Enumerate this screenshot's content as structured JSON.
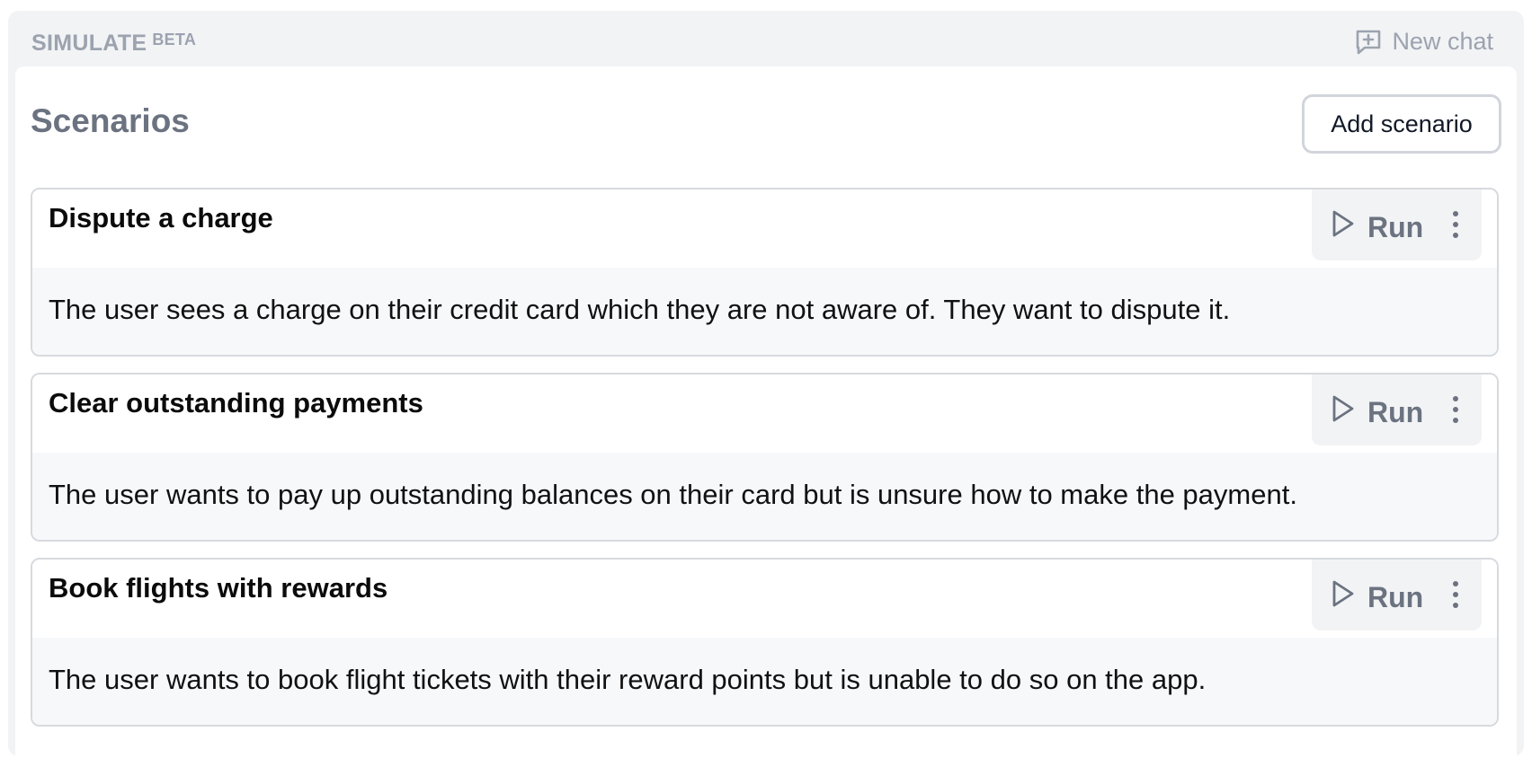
{
  "header": {
    "brand": "SIMULATE",
    "badge": "BETA",
    "new_chat_label": "New chat"
  },
  "main": {
    "title": "Scenarios",
    "add_scenario_label": "Add scenario",
    "scenarios": [
      {
        "title": "Dispute a charge",
        "description": "The user sees a charge on their credit card which they are not aware of. They want to dispute it.",
        "run_label": "Run"
      },
      {
        "title": "Clear outstanding payments",
        "description": "The user wants to pay up outstanding balances on their card but is unsure how to make the payment.",
        "run_label": "Run"
      },
      {
        "title": "Book flights with rewards",
        "description": "The user wants to book flight tickets with their reward points but is unable to do so on the app.",
        "run_label": "Run"
      }
    ]
  },
  "icons": {
    "new_chat": "message-plus-icon",
    "run": "play-icon",
    "more": "more-vertical-icon"
  },
  "colors": {
    "panel_bg": "#f2f3f5",
    "muted_text": "#9ca3af",
    "title_text": "#6b7280",
    "card_border": "#d7dade"
  }
}
